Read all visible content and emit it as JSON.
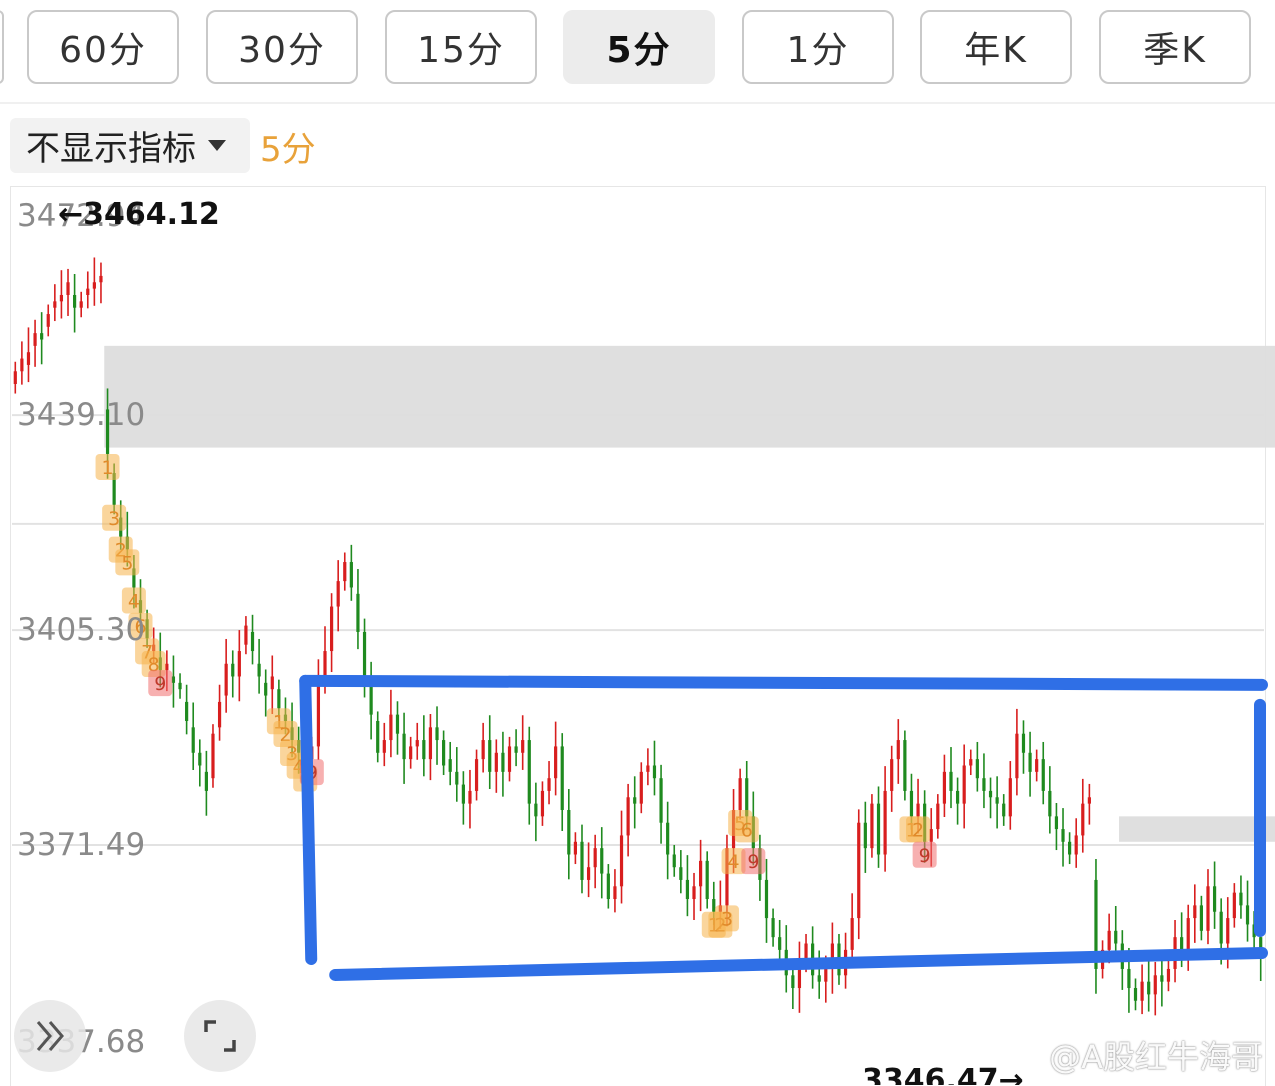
{
  "tabs": [
    "60分",
    "30分",
    "15分",
    "5分",
    "1分",
    "年K",
    "季K"
  ],
  "active_tab_index": 3,
  "indicator_select": {
    "label": "不显示指标",
    "caret_icon": "caret-down-icon"
  },
  "period_label": "5分",
  "watermark": "@A股红牛海哥",
  "expand_icon": "double-chevron-right-icon",
  "fullscreen_icon": "fullscreen-corners-icon",
  "colors": {
    "up": "#d81e1e",
    "down": "#1f8a1f",
    "annotation": "#2f6fe6",
    "zone": "#dddddd",
    "td_count": "#f5b24a",
    "td_nine": "#f07070"
  },
  "chart_data": {
    "type": "candlestick",
    "y_ticks": [
      "3472.94",
      "3439.10",
      "3405.30",
      "3371.49",
      "3337.68"
    ],
    "ylim": [
      3337.68,
      3472.94
    ],
    "high_label": "←3464.12",
    "low_label": "3346.47→",
    "high_value": 3464.12,
    "low_value": 3346.47,
    "series_close": [
      3446,
      3448,
      3449,
      3452,
      3451,
      3455,
      3457,
      3458,
      3460,
      3456,
      3457,
      3459,
      3460,
      3461,
      3433,
      3425,
      3420,
      3418,
      3412,
      3408,
      3404,
      3403,
      3399,
      3400,
      3397,
      3396,
      3391,
      3386,
      3384,
      3380,
      3389,
      3394,
      3400,
      3398,
      3402,
      3406,
      3402,
      3398,
      3395,
      3398,
      3393,
      3391,
      3388,
      3386,
      3384,
      3387,
      3398,
      3402,
      3409,
      3413,
      3416,
      3412,
      3405,
      3398,
      3392,
      3386,
      3388,
      3392,
      3389,
      3385,
      3387,
      3388,
      3385,
      3390,
      3388,
      3384,
      3383,
      3381,
      3378,
      3380,
      3385,
      3388,
      3383,
      3386,
      3383,
      3387,
      3386,
      3388,
      3378,
      3376,
      3380,
      3382,
      3387,
      3377,
      3370,
      3372,
      3366,
      3368,
      3371,
      3367,
      3363,
      3365,
      3373,
      3379,
      3378,
      3383,
      3384,
      3382,
      3375,
      3370,
      3368,
      3366,
      3363,
      3365,
      3369,
      3363,
      3361,
      3362,
      3371,
      3377,
      3382,
      3376,
      3371,
      3366,
      3360,
      3357,
      3355,
      3351,
      3349,
      3353,
      3356,
      3351,
      3350,
      3352,
      3356,
      3351,
      3355,
      3360,
      3375,
      3371,
      3378,
      3370,
      3380,
      3385,
      3388,
      3380,
      3376,
      3378,
      3372,
      3374,
      3378,
      3383,
      3380,
      3378,
      3384,
      3385,
      3382,
      3380,
      3379,
      3378,
      3376,
      3382,
      3389,
      3386,
      3383,
      3385,
      3380,
      3376,
      3374,
      3372,
      3370,
      3373,
      3378,
      3379,
      3352,
      3355,
      3358,
      3356,
      3352,
      3349,
      3347,
      3350,
      3348,
      3351,
      3350,
      3352,
      3357,
      3355,
      3360,
      3362,
      3358,
      3365,
      3361,
      3356,
      3360,
      3364,
      3362,
      3359,
      3357,
      3354
    ],
    "series_open": [
      3444,
      3446,
      3447,
      3450,
      3452,
      3453,
      3456,
      3457,
      3458,
      3458,
      3456,
      3458,
      3459,
      3460,
      3440,
      3430,
      3423,
      3420,
      3415,
      3410,
      3407,
      3402,
      3401,
      3399,
      3398,
      3397,
      3394,
      3390,
      3386,
      3383,
      3382,
      3390,
      3395,
      3400,
      3398,
      3403,
      3405,
      3400,
      3397,
      3396,
      3396,
      3392,
      3390,
      3388,
      3386,
      3385,
      3387,
      3398,
      3402,
      3409,
      3413,
      3416,
      3411,
      3405,
      3397,
      3391,
      3386,
      3388,
      3392,
      3389,
      3385,
      3387,
      3388,
      3385,
      3390,
      3388,
      3385,
      3383,
      3381,
      3378,
      3380,
      3385,
      3388,
      3383,
      3386,
      3383,
      3387,
      3386,
      3388,
      3378,
      3376,
      3380,
      3382,
      3387,
      3377,
      3370,
      3372,
      3366,
      3368,
      3371,
      3367,
      3363,
      3365,
      3373,
      3379,
      3378,
      3383,
      3384,
      3382,
      3375,
      3370,
      3368,
      3366,
      3363,
      3365,
      3369,
      3363,
      3361,
      3362,
      3371,
      3377,
      3382,
      3376,
      3371,
      3366,
      3360,
      3357,
      3355,
      3351,
      3349,
      3353,
      3356,
      3351,
      3350,
      3352,
      3356,
      3351,
      3355,
      3360,
      3375,
      3371,
      3378,
      3370,
      3380,
      3385,
      3388,
      3380,
      3376,
      3378,
      3372,
      3374,
      3378,
      3383,
      3380,
      3378,
      3384,
      3385,
      3382,
      3380,
      3379,
      3378,
      3376,
      3382,
      3389,
      3386,
      3383,
      3385,
      3380,
      3376,
      3374,
      3372,
      3370,
      3373,
      3378,
      3366,
      3352,
      3355,
      3358,
      3356,
      3352,
      3349,
      3347,
      3350,
      3348,
      3351,
      3350,
      3352,
      3357,
      3355,
      3360,
      3362,
      3358,
      3365,
      3361,
      3356,
      3360,
      3364,
      3362,
      3359,
      3357
    ],
    "resistance_zones": [
      {
        "from_index": 14,
        "to_index": 191,
        "low": 3434,
        "high": 3450
      },
      {
        "from_index": 168,
        "to_index": 191,
        "low": 3372,
        "high": 3376
      }
    ],
    "annotation_box": {
      "from_index": 44,
      "to_index": 191,
      "low": 3352,
      "high": 3397
    },
    "td_sequences": [
      {
        "start_index": 14,
        "labels": [
          "1",
          "3",
          "2",
          "5",
          "4",
          "6",
          "7",
          "8",
          "9"
        ]
      },
      {
        "start_index": 40,
        "labels": [
          "1",
          "2",
          "3",
          "4",
          "6",
          "9"
        ]
      },
      {
        "start_index": 106,
        "labels": [
          "1",
          "2",
          "3",
          "4",
          "5",
          "6",
          "9"
        ]
      },
      {
        "start_index": 136,
        "labels": [
          "1",
          "2",
          "9"
        ]
      }
    ]
  }
}
